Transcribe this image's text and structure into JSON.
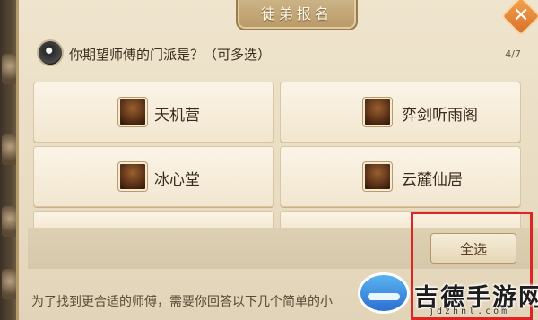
{
  "dialog": {
    "title": "徒弟报名",
    "close_glyph": "✕"
  },
  "question": {
    "text": "你期望师傅的门派是？（可多选）",
    "progress": "4/7"
  },
  "options": [
    {
      "label": "天机营"
    },
    {
      "label": "弈剑听雨阁"
    },
    {
      "label": "冰心堂"
    },
    {
      "label": "云麓仙居"
    }
  ],
  "select_all_label": "全选",
  "footer_hint": "为了找到更合适的师傅，需要你回答以下几个简单的小",
  "watermark": {
    "name": "吉德手游网",
    "domain": "jdzhnl.com"
  },
  "colors": {
    "highlight_border": "#e02424",
    "close_button": "#e0802f"
  }
}
